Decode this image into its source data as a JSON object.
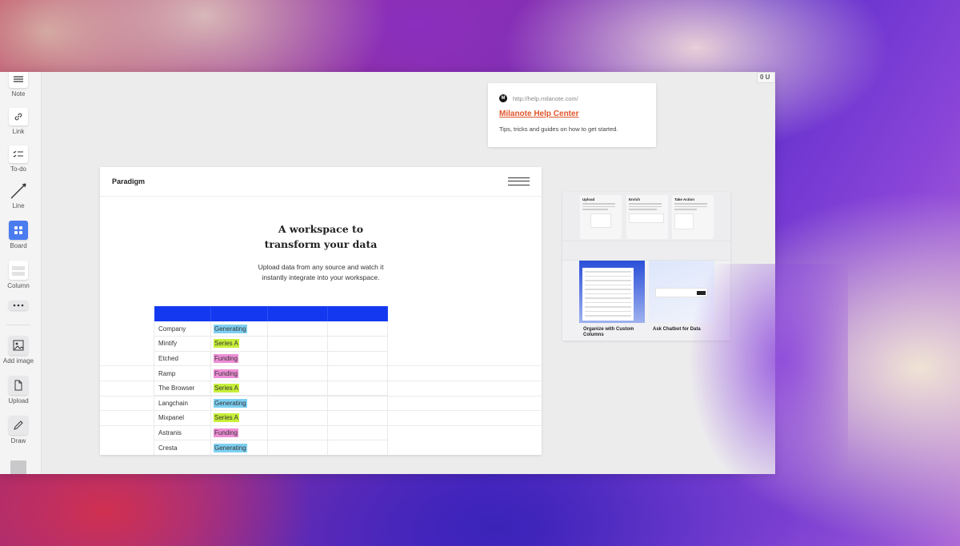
{
  "toolbar": {
    "items": [
      {
        "label": "Note",
        "icon": "note-icon"
      },
      {
        "label": "Link",
        "icon": "link-icon"
      },
      {
        "label": "To-do",
        "icon": "checklist-icon"
      },
      {
        "label": "Line",
        "icon": "line-icon"
      },
      {
        "label": "Board",
        "icon": "board-icon"
      },
      {
        "label": "Column",
        "icon": "column-icon"
      },
      {
        "label": "",
        "icon": "more-icon"
      },
      {
        "label": "Add image",
        "icon": "image-icon"
      },
      {
        "label": "Upload",
        "icon": "file-icon"
      },
      {
        "label": "Draw",
        "icon": "pencil-icon"
      }
    ]
  },
  "counter": "0 U",
  "help_card": {
    "url": "http://help.milanote.com/",
    "title": "Milanote Help Center",
    "description": "Tips, tricks and guides on how to get started."
  },
  "preview": {
    "brand": "Paradigm",
    "headline": "A workspace to transform your data",
    "subtitle": "Upload data from any source and watch it instantly integrate into your workspace.",
    "rows": [
      {
        "company": "Company",
        "status": "Generating",
        "color": "blue"
      },
      {
        "company": "Mintify",
        "status": "Series A",
        "color": "green"
      },
      {
        "company": "Etched",
        "status": "Funding",
        "color": "pink"
      },
      {
        "company": "Ramp",
        "status": "Funding",
        "color": "pink"
      },
      {
        "company": "The Browser",
        "status": "Series A",
        "color": "green"
      },
      {
        "company": "Langchain",
        "status": "Generating",
        "color": "blue"
      },
      {
        "company": "Mixpanel",
        "status": "Series A",
        "color": "green"
      },
      {
        "company": "Astranis",
        "status": "Funding",
        "color": "pink"
      },
      {
        "company": "Cresta",
        "status": "Generating",
        "color": "blue"
      }
    ]
  },
  "image_card": {
    "columns": [
      "Upload",
      "Enrich",
      "Take Action"
    ],
    "captions": [
      "Organize with Custom Columns",
      "Ask Chatbot for Data"
    ]
  },
  "colors": {
    "table_header": "#1438f0",
    "tag_blue": "#7ed0f2",
    "tag_green": "#c8ef3a",
    "tag_pink": "#ee8fd6",
    "link": "#e0542b",
    "board_icon": "#4a7cf0"
  }
}
